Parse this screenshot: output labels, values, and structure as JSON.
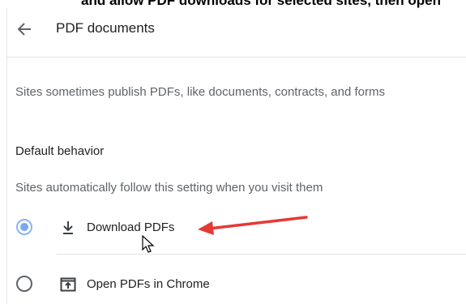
{
  "top_strip_text": "and allow PDF downloads for selected sites, then open",
  "header": {
    "title": "PDF documents"
  },
  "description": "Sites sometimes publish PDFs, like documents, contracts, and forms",
  "default_behavior": {
    "heading": "Default behavior",
    "subtitle": "Sites automatically follow this setting when you visit them",
    "options": [
      {
        "label": "Download PDFs",
        "icon": "download-icon",
        "selected": true
      },
      {
        "label": "Open PDFs in Chrome",
        "icon": "open-in-browser-icon",
        "selected": false
      }
    ]
  },
  "colors": {
    "radio_selected": "#7aa7f0",
    "annotation_arrow": "#e53935"
  }
}
